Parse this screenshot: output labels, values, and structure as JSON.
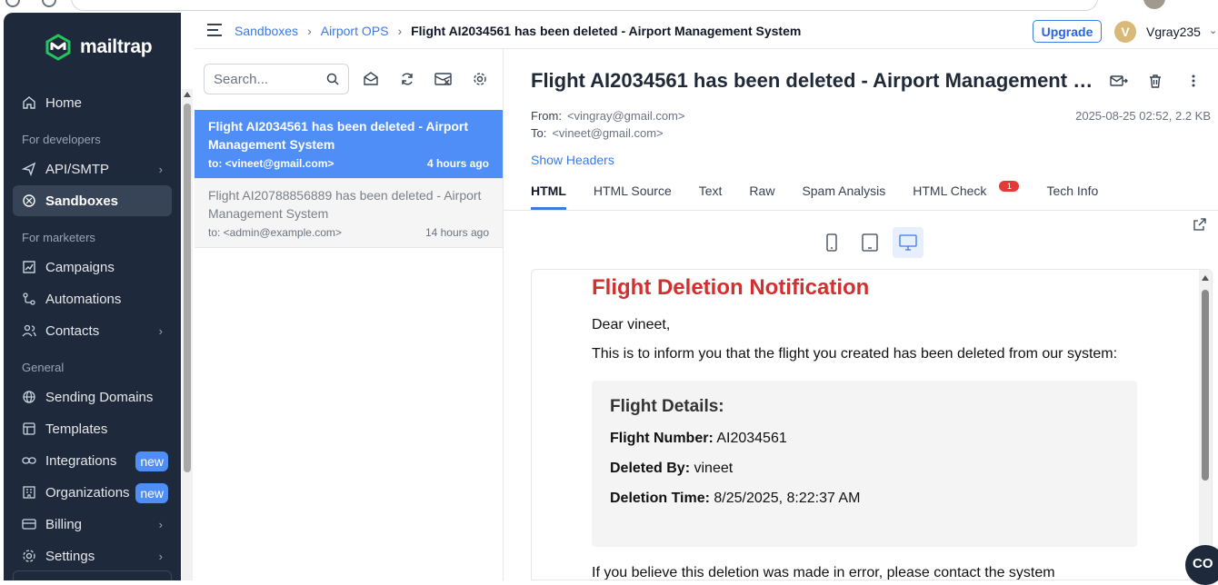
{
  "brand": {
    "name": "mailtrap",
    "accent": "#4f8ef7",
    "sidebar_bg": "#1e2a3b"
  },
  "header": {
    "breadcrumbs": [
      "Sandboxes",
      "Airport OPS",
      "Flight AI2034561 has been deleted - Airport Management System"
    ],
    "upgrade_label": "Upgrade",
    "avatar_initial": "V",
    "username": "Vgray235"
  },
  "sidebar": {
    "home": "Home",
    "section_dev": "For developers",
    "api_smtp": "API/SMTP",
    "sandboxes": "Sandboxes",
    "section_marketers": "For marketers",
    "campaigns": "Campaigns",
    "automations": "Automations",
    "contacts": "Contacts",
    "section_general": "General",
    "sending_domains": "Sending Domains",
    "templates": "Templates",
    "integrations": "Integrations",
    "organizations": "Organizations",
    "billing": "Billing",
    "settings": "Settings",
    "new_badge": "new"
  },
  "inbox": {
    "search_placeholder": "Search...",
    "messages": [
      {
        "subject": "Flight AI2034561 has been deleted - Airport Management System",
        "to": "to: <vineet@gmail.com>",
        "time": "4 hours ago"
      },
      {
        "subject": "Flight AI20788856889 has been deleted - Airport Management System",
        "to": "to: <admin@example.com>",
        "time": "14 hours ago"
      }
    ]
  },
  "message": {
    "title": "Flight AI2034561 has been deleted - Airport Management System",
    "from_label": "From:",
    "from": "<vingray@gmail.com>",
    "to_label": "To:",
    "to": "<vineet@gmail.com>",
    "datetime_size": "2025-08-25 02:52, 2.2 KB",
    "show_headers": "Show Headers",
    "tabs": [
      "HTML",
      "HTML Source",
      "Text",
      "Raw",
      "Spam Analysis",
      "HTML Check",
      "Tech Info"
    ],
    "html_check_count": "1"
  },
  "email": {
    "heading": "Flight Deletion Notification",
    "greeting": "Dear vineet,",
    "intro": "This is to inform you that the flight you created has been deleted from our system:",
    "details_title": "Flight Details:",
    "flight_number_label": "Flight Number:",
    "flight_number": "AI2034561",
    "deleted_by_label": "Deleted By:",
    "deleted_by": "vineet",
    "deletion_time_label": "Deletion Time:",
    "deletion_time": "8/25/2025, 8:22:37 AM",
    "footer": "If you believe this deletion was made in error, please contact the system"
  },
  "chat_label": "CO"
}
